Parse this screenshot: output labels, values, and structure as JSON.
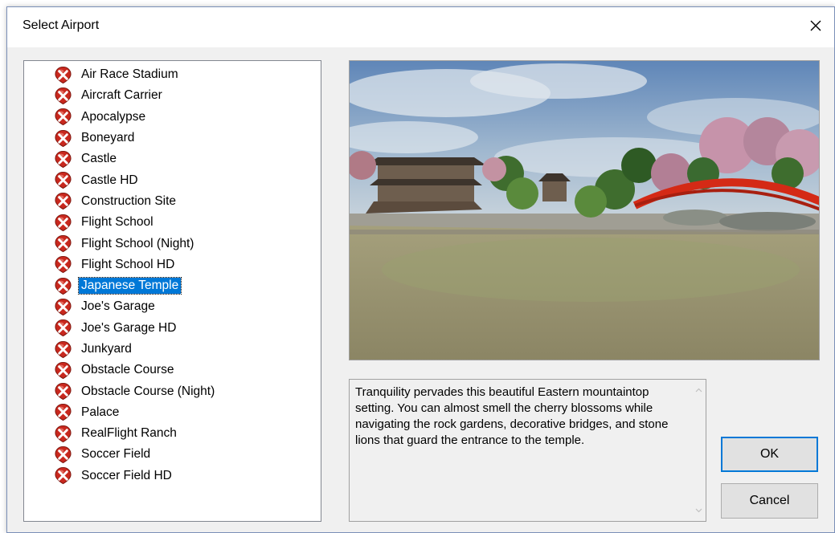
{
  "window": {
    "title": "Select Airport",
    "close_glyph": "✕"
  },
  "airports": [
    {
      "label": "Air Race Stadium"
    },
    {
      "label": "Aircraft Carrier"
    },
    {
      "label": "Apocalypse"
    },
    {
      "label": "Boneyard"
    },
    {
      "label": "Castle"
    },
    {
      "label": "Castle HD"
    },
    {
      "label": "Construction Site"
    },
    {
      "label": "Flight School"
    },
    {
      "label": "Flight School (Night)"
    },
    {
      "label": "Flight School HD"
    },
    {
      "label": "Japanese Temple",
      "selected": true
    },
    {
      "label": "Joe's Garage"
    },
    {
      "label": "Joe's Garage HD"
    },
    {
      "label": "Junkyard"
    },
    {
      "label": "Obstacle Course"
    },
    {
      "label": "Obstacle Course (Night)"
    },
    {
      "label": "Palace"
    },
    {
      "label": "RealFlight Ranch"
    },
    {
      "label": "Soccer Field"
    },
    {
      "label": "Soccer Field HD"
    }
  ],
  "item_icon": "airport-pin-icon",
  "description": "Tranquility pervades this beautiful Eastern mountaintop setting.  You can almost smell the cherry blossoms while navigating the rock gardens, decorative bridges, and stone lions that guard the entrance to the temple.",
  "buttons": {
    "ok": "OK",
    "cancel": "Cancel"
  },
  "colors": {
    "selection": "#0078d7",
    "icon_red": "#c8281e",
    "default_button_border": "#0078d7"
  }
}
